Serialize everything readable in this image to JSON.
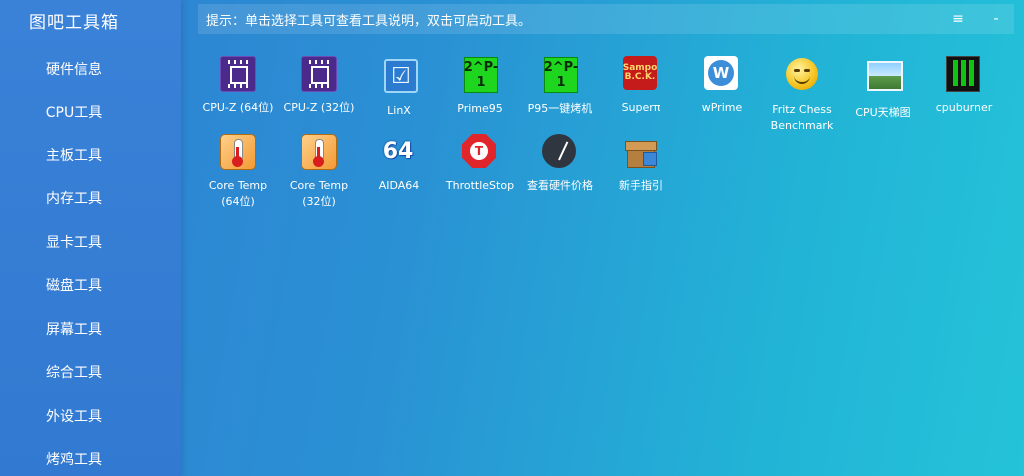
{
  "app": {
    "title": "图吧工具箱"
  },
  "sidebar": {
    "items": [
      {
        "label": "硬件信息"
      },
      {
        "label": "CPU工具"
      },
      {
        "label": "主板工具"
      },
      {
        "label": "内存工具"
      },
      {
        "label": "显卡工具"
      },
      {
        "label": "磁盘工具"
      },
      {
        "label": "屏幕工具"
      },
      {
        "label": "综合工具"
      },
      {
        "label": "外设工具"
      },
      {
        "label": "烤鸡工具"
      }
    ]
  },
  "hint": {
    "text": "提示：单击选择工具可查看工具说明，双击可启动工具。"
  },
  "window": {
    "menu_glyph": "≡",
    "minimize_glyph": "-"
  },
  "tools": [
    {
      "label": "CPU-Z (64位)",
      "icon": "cpu-z-chip-icon"
    },
    {
      "label": "CPU-Z (32位)",
      "icon": "cpu-z-chip-icon"
    },
    {
      "label": "LinX",
      "icon": "linx-check-icon",
      "glyph": "☑"
    },
    {
      "label": "Prime95",
      "icon": "prime95-icon",
      "glyph": "2^P-1"
    },
    {
      "label": "P95一键烤机",
      "icon": "prime95-icon",
      "glyph": "2^P-1"
    },
    {
      "label": "Superπ",
      "icon": "superpi-icon",
      "glyph": "Sampo\nB.C.K."
    },
    {
      "label": "wPrime",
      "icon": "wprime-icon",
      "glyph": "W"
    },
    {
      "label": "Fritz Chess\nBenchmark",
      "icon": "smiley-icon"
    },
    {
      "label": "CPU天梯图",
      "icon": "picture-icon"
    },
    {
      "label": "cpuburner",
      "icon": "cpuburner-icon"
    },
    {
      "label": "Core Temp\n(64位)",
      "icon": "thermometer-icon"
    },
    {
      "label": "Core Temp\n(32位)",
      "icon": "thermometer-icon"
    },
    {
      "label": "AIDA64",
      "icon": "aida64-icon",
      "glyph": "64"
    },
    {
      "label": "ThrottleStop",
      "icon": "stop-sign-icon",
      "glyph": "T"
    },
    {
      "label": "查看硬件价格",
      "icon": "price-dial-icon"
    },
    {
      "label": "新手指引",
      "icon": "package-icon"
    }
  ]
}
